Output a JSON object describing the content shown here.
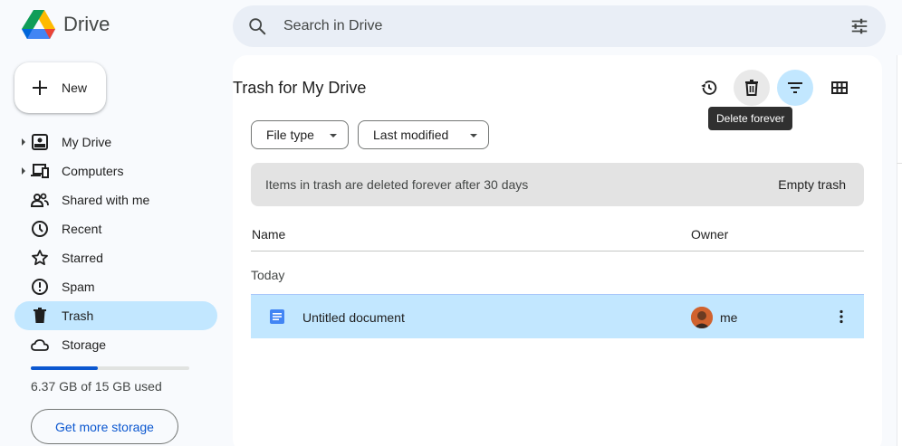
{
  "app": {
    "title": "Drive"
  },
  "search": {
    "placeholder": "Search in Drive"
  },
  "new_button": {
    "label": "New"
  },
  "sidebar": {
    "items": [
      {
        "label": "My Drive",
        "icon": "my-drive-icon",
        "expandable": true
      },
      {
        "label": "Computers",
        "icon": "computers-icon",
        "expandable": true
      },
      {
        "label": "Shared with me",
        "icon": "shared-icon",
        "expandable": false
      },
      {
        "label": "Recent",
        "icon": "clock-icon",
        "expandable": false
      },
      {
        "label": "Starred",
        "icon": "star-icon",
        "expandable": false
      },
      {
        "label": "Spam",
        "icon": "spam-icon",
        "expandable": false
      },
      {
        "label": "Trash",
        "icon": "trash-icon",
        "expandable": false,
        "active": true
      },
      {
        "label": "Storage",
        "icon": "cloud-icon",
        "expandable": false
      }
    ],
    "storage": {
      "used_text": "6.37 GB of 15 GB used",
      "fraction": 0.42
    },
    "more_storage_label": "Get more storage"
  },
  "main": {
    "title": "Trash for My Drive",
    "tooltip": "Delete forever",
    "filters": [
      {
        "label": "File type"
      },
      {
        "label": "Last modified"
      }
    ],
    "banner": {
      "text": "Items in trash are deleted forever after 30 days",
      "action": "Empty trash"
    },
    "columns": {
      "name": "Name",
      "owner": "Owner"
    },
    "section": "Today",
    "files": [
      {
        "name": "Untitled document",
        "owner": "me",
        "type": "google-doc"
      }
    ]
  },
  "colors": {
    "accent": "#0b57d0",
    "selected": "#c2e7ff",
    "doc": "#4285f4"
  }
}
